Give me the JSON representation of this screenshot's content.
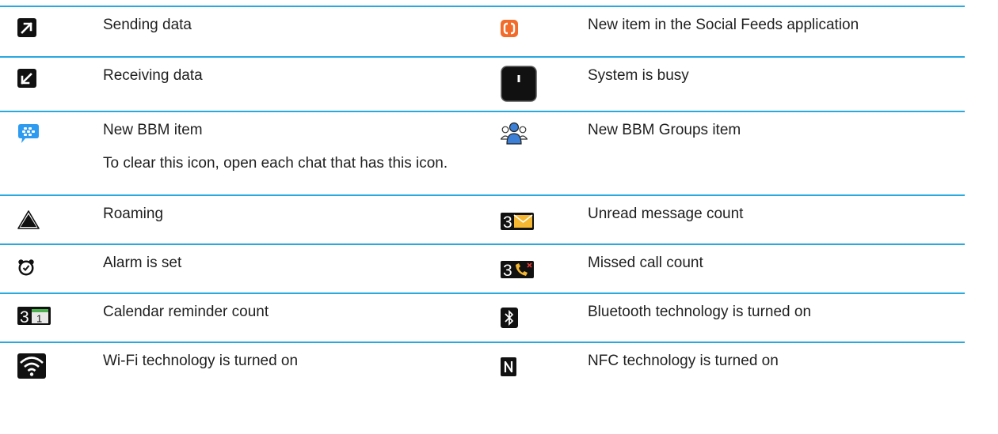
{
  "rows": [
    {
      "left": {
        "icon": "sending-data-arrow-icon",
        "label": "Sending data"
      },
      "right": {
        "icon": "social-feeds-icon",
        "label": "New item in the Social Feeds application",
        "color": "#f26b2a"
      }
    },
    {
      "left": {
        "icon": "receiving-data-arrow-icon",
        "label": "Receiving data"
      },
      "right": {
        "icon": "system-busy-icon",
        "label": "System is busy"
      }
    },
    {
      "left": {
        "icon": "bbm-icon",
        "label": "New BBM item",
        "note": "To clear this icon, open each chat that has this icon.",
        "color": "#2d9bf0"
      },
      "right": {
        "icon": "bbm-groups-icon",
        "label": "New BBM Groups item",
        "color": "#3b7fd6"
      }
    },
    {
      "left": {
        "icon": "roaming-triangle-icon",
        "label": "Roaming"
      },
      "right": {
        "icon": "unread-message-count-icon",
        "label": "Unread message count",
        "count": "3",
        "color": "#f5b731"
      }
    },
    {
      "left": {
        "icon": "alarm-clock-icon",
        "label": "Alarm is set"
      },
      "right": {
        "icon": "missed-call-count-icon",
        "label": "Missed call count",
        "count": "3",
        "color": "#f5b731"
      }
    },
    {
      "left": {
        "icon": "calendar-reminder-count-icon",
        "label": "Calendar reminder count",
        "count": "3",
        "day": "1",
        "color": "#4caf50"
      },
      "right": {
        "icon": "bluetooth-icon",
        "label": "Bluetooth technology is turned on"
      }
    },
    {
      "left": {
        "icon": "wifi-icon",
        "label": "Wi-Fi technology is turned on"
      },
      "right": {
        "icon": "nfc-icon",
        "label": "NFC technology is turned on"
      }
    }
  ]
}
